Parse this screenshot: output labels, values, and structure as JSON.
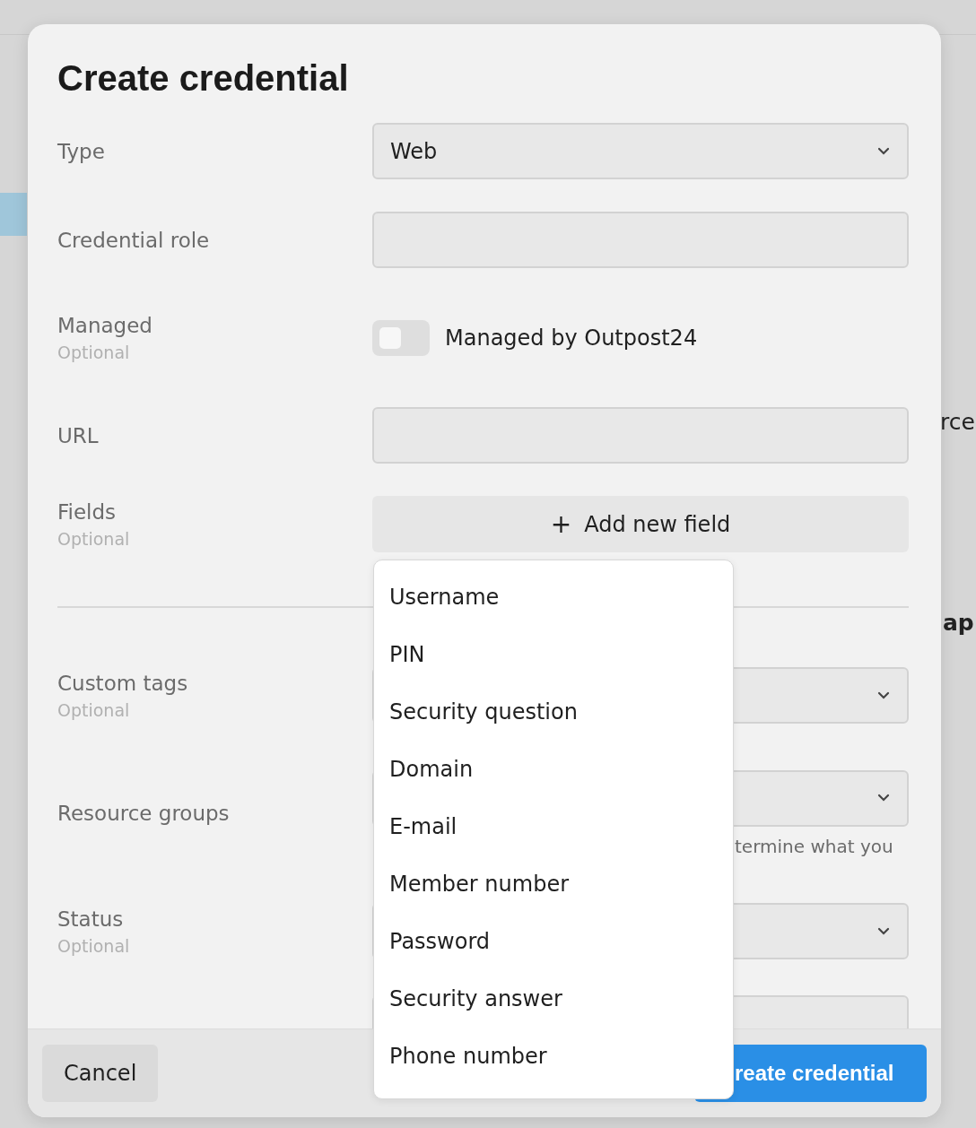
{
  "background": {
    "fragments": [
      "rce",
      "ap"
    ]
  },
  "dialog": {
    "title": "Create credential",
    "sections": [
      {
        "rows": [
          {
            "kind": "select",
            "label": "Type",
            "value": "Web"
          },
          {
            "kind": "input",
            "label": "Credential role"
          },
          {
            "kind": "toggle",
            "label": "Managed",
            "optional": "Optional",
            "on": false,
            "text": "Managed by Outpost24"
          },
          {
            "kind": "input",
            "label": "URL"
          },
          {
            "kind": "add",
            "label": "Fields",
            "optional": "Optional",
            "icon": "+",
            "text": "Add new field"
          }
        ]
      },
      {
        "rows": [
          {
            "kind": "select",
            "label": "Custom tags",
            "optional": "Optional"
          },
          {
            "kind": "select",
            "label": "Resource groups",
            "helper": "termine what you"
          },
          {
            "kind": "select",
            "label": "Status",
            "optional": "Optional"
          },
          {
            "kind": "input"
          }
        ]
      }
    ],
    "menu": {
      "items": [
        "Username",
        "PIN",
        "Security question",
        "Domain",
        "E-mail",
        "Member number",
        "Password",
        "Security answer",
        "Phone number"
      ]
    },
    "footer": {
      "cancel": "Cancel",
      "submit": "reate credential"
    }
  }
}
